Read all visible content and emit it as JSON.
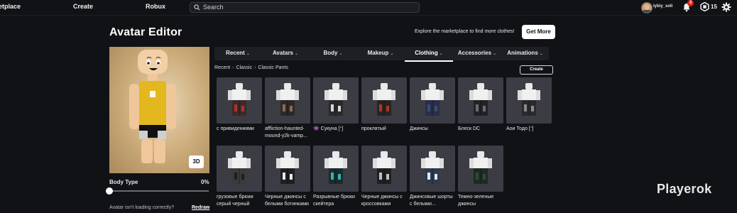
{
  "topbar": {
    "nav": [
      "etplace",
      "Create",
      "Robux"
    ],
    "search_placeholder": "Search",
    "username": "lybiy_soli",
    "notification_count": "3",
    "robux_count": "15"
  },
  "page_title": "Avatar Editor",
  "explore_text": "Explore the marketplace to find more clothes!",
  "get_more_label": "Get More",
  "preview": {
    "button_3d": "3D",
    "body_type_label": "Body Type",
    "body_type_value": "0%",
    "body_type_fraction": 0,
    "loading_question": "Avatar isn't loading correctly?",
    "redraw_label": "Redraw"
  },
  "tabs": [
    {
      "label": "Recent",
      "active": false
    },
    {
      "label": "Avatars",
      "active": false
    },
    {
      "label": "Body",
      "active": false
    },
    {
      "label": "Makeup",
      "active": false
    },
    {
      "label": "Clothing",
      "active": true
    },
    {
      "label": "Accessories",
      "active": false
    },
    {
      "label": "Animations",
      "active": false
    }
  ],
  "breadcrumb": [
    "Recent",
    "Classic",
    "Classic Pants"
  ],
  "create_label": "Create",
  "items": [
    {
      "line1": "с привидениями",
      "line2": "",
      "line3": "",
      "pants": "#3a2b2a",
      "accent": "#b0322c"
    },
    {
      "line1": "affliction-haunted-",
      "line2": "mound-y2k-vamp...",
      "line3": "",
      "pants": "#2c2827",
      "accent": "#8a6a55"
    },
    {
      "line1": "👾 Сукуна [ᐩ]",
      "line2": "",
      "line3": "",
      "pants": "#2a2a2a",
      "accent": "#d8d8d8"
    },
    {
      "line1": "проклятый",
      "line2": "",
      "line3": "",
      "pants": "#2b2222",
      "accent": "#a8372c"
    },
    {
      "line1": "Джинсы",
      "line2": "",
      "line3": "",
      "pants": "#27304a",
      "accent": "#3b4a70"
    },
    {
      "line1": "Блеск DC",
      "line2": "",
      "line3": "",
      "pants": "#222227",
      "accent": "#6a6a72"
    },
    {
      "line1": "Аои Тодо [ᐩ]",
      "line2": "",
      "line3": "",
      "pants": "#2a2a2d",
      "accent": "#8a8a8a"
    },
    {
      "line1": "грузовые брюки",
      "line2": "серый черный",
      "line3": "",
      "pants": "#3b3b3d",
      "accent": "#1e1e1e"
    },
    {
      "line1": "Черные джинсы с",
      "line2": "белыми ботинками",
      "line3": "",
      "pants": "#1f1f22",
      "accent": "#e8e8e8"
    },
    {
      "line1": "Разрывные брюки",
      "line2": "скейтера",
      "line3": "",
      "pants": "#1c2a2b",
      "accent": "#2fb6b0"
    },
    {
      "line1": "Черные джинсы с",
      "line2": "кроссовками",
      "line3": "",
      "pants": "#1f1f22",
      "accent": "#bfbfbf"
    },
    {
      "line1": "Джинсовые шорты",
      "line2": "с белыми...",
      "line3": "",
      "pants": "#2e3a52",
      "accent": "#e6e6e6"
    },
    {
      "line1": "Темно-зеленые",
      "line2": "джинсы",
      "line3": "",
      "pants": "#1e2b22",
      "accent": "#2f4a36"
    }
  ],
  "watermark": "Playerok",
  "colors": {
    "background": "#111216",
    "card": "#3c3d44",
    "badge": "#e2231a"
  }
}
